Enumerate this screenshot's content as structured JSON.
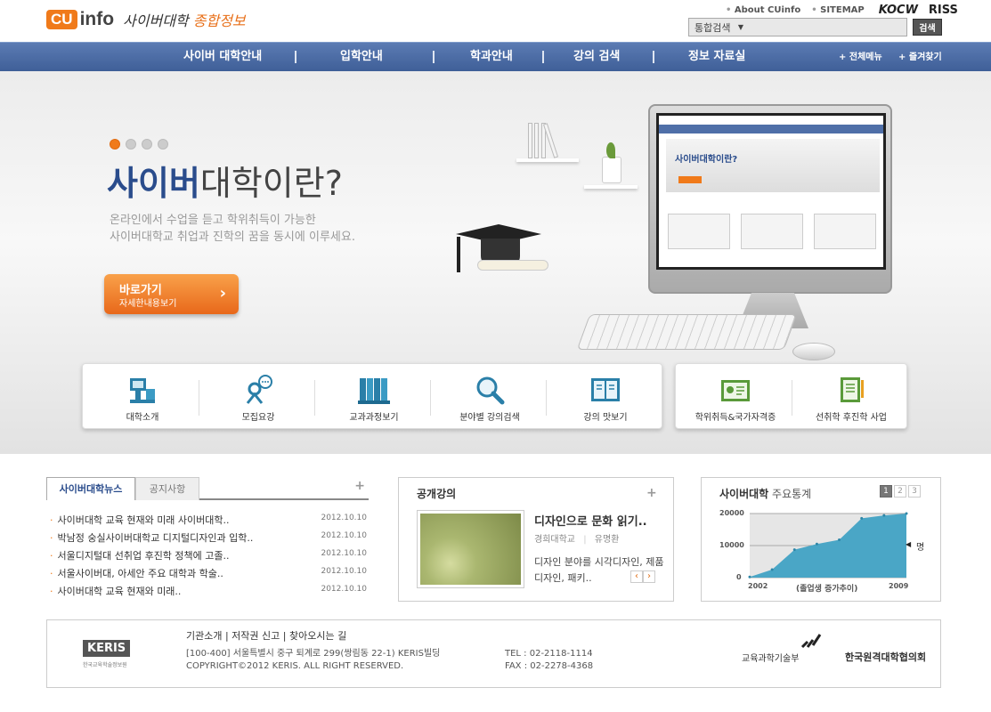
{
  "header": {
    "logo_cu": "CU",
    "logo_info": "info",
    "logo_script": "사이버대학",
    "logo_script2": "종합정보",
    "links": {
      "about": "About CUinfo",
      "sitemap": "SITEMAP",
      "kocw": "KOCW",
      "riss": "RISS"
    },
    "search": {
      "select": "통합검색",
      "button": "검색",
      "value": ""
    }
  },
  "nav": {
    "items": [
      "사이버 대학안내",
      "입학안내",
      "학과안내",
      "강의 검색",
      "정보 자료실"
    ],
    "all_menu": "전체메뉴",
    "favorites": "즐겨찾기"
  },
  "hero": {
    "title_strong": "사이버",
    "title_rest": "대학이란?",
    "subtitle_line1": "온라인에서 수업을 듣고 학위취득이 가능한",
    "subtitle_line2": "사이버대학교 취업과 진학의 꿈을 동시에 이루세요.",
    "cta_title": "바로가기",
    "cta_sub": "자세한내용보기",
    "slides": 4,
    "active_slide": 1,
    "screen_text": "사이버대학이란?"
  },
  "quick_menu": {
    "group1": [
      {
        "label": "대학소개",
        "icon": "building-icon"
      },
      {
        "label": "모집요강",
        "icon": "person-speech-icon"
      },
      {
        "label": "교과과정보기",
        "icon": "books-icon"
      },
      {
        "label": "분야별 강의검색",
        "icon": "magnifier-icon"
      },
      {
        "label": "강의 맛보기",
        "icon": "open-book-icon"
      }
    ],
    "group2": [
      {
        "label": "학위취득&국가자격증",
        "icon": "certificate-icon"
      },
      {
        "label": "선취학 후진학 사업",
        "icon": "notebook-icon"
      }
    ]
  },
  "news": {
    "tab_active": "사이버대학뉴스",
    "tab_other": "공지사항",
    "items": [
      {
        "title": "사이버대학 교육 현재와 미래 사이버대학..",
        "date": "2012.10.10"
      },
      {
        "title": "박남정 숭실사이버대학교 디지털디자인과 입학..",
        "date": "2012.10.10"
      },
      {
        "title": "서울디지털대 선취업 후진학 정책에 고졸..",
        "date": "2012.10.10"
      },
      {
        "title": "서울사이버대, 아세안 주요 대학과 학술..",
        "date": "2012.10.10"
      },
      {
        "title": "사이버대학 교육 현재와 미래..",
        "date": "2012.10.10"
      }
    ]
  },
  "lecture": {
    "title": "공개강의",
    "lecture_title": "디자인으로 문화 읽기..",
    "school": "경희대학교",
    "professor": "유명환",
    "desc": "디자인 분야를 시각디자인, 제품디자인, 패키..",
    "prev": "‹",
    "next": "›"
  },
  "stats": {
    "title_a": "사이버대학",
    "title_b": "주요통계",
    "pages": [
      "1",
      "2",
      "3"
    ],
    "active_page": "1",
    "unit": "명"
  },
  "chart_data": {
    "type": "area",
    "x": [
      2002,
      2003,
      2004,
      2005,
      2006,
      2007,
      2008,
      2009
    ],
    "values": [
      200,
      2500,
      8700,
      10500,
      11800,
      18500,
      19400,
      20000
    ],
    "x_start_label": "2002",
    "x_end_label": "2009",
    "xlabel": "(졸업생 증가추이)",
    "ylabel": "명",
    "yticks": [
      "0",
      "10000",
      "20000"
    ],
    "ylim": [
      0,
      20000
    ],
    "grid": true,
    "color": "#4aa6c6"
  },
  "footer": {
    "links": "기관소개 | 저작권 신고 | 찾아오시는 길",
    "address": "[100-400] 서울특별시 중구 퇴계로 299(쌍림동 22-1) KERIS빌딩",
    "copyright": "COPYRIGHT©2012 KERIS. ALL RIGHT RESERVED.",
    "tel": "TEL : 02-2118-1114",
    "fax": "FAX : 02-2278-4368",
    "keris": "KERIS",
    "keris_sub": "한국교육학술정보원",
    "mest": "교육과학기술부",
    "kcu": "한국원격대학협의회"
  },
  "colors": {
    "accent": "#f07a1a",
    "nav": "#4a6aa3",
    "brand_blue": "#2a4c8c"
  }
}
